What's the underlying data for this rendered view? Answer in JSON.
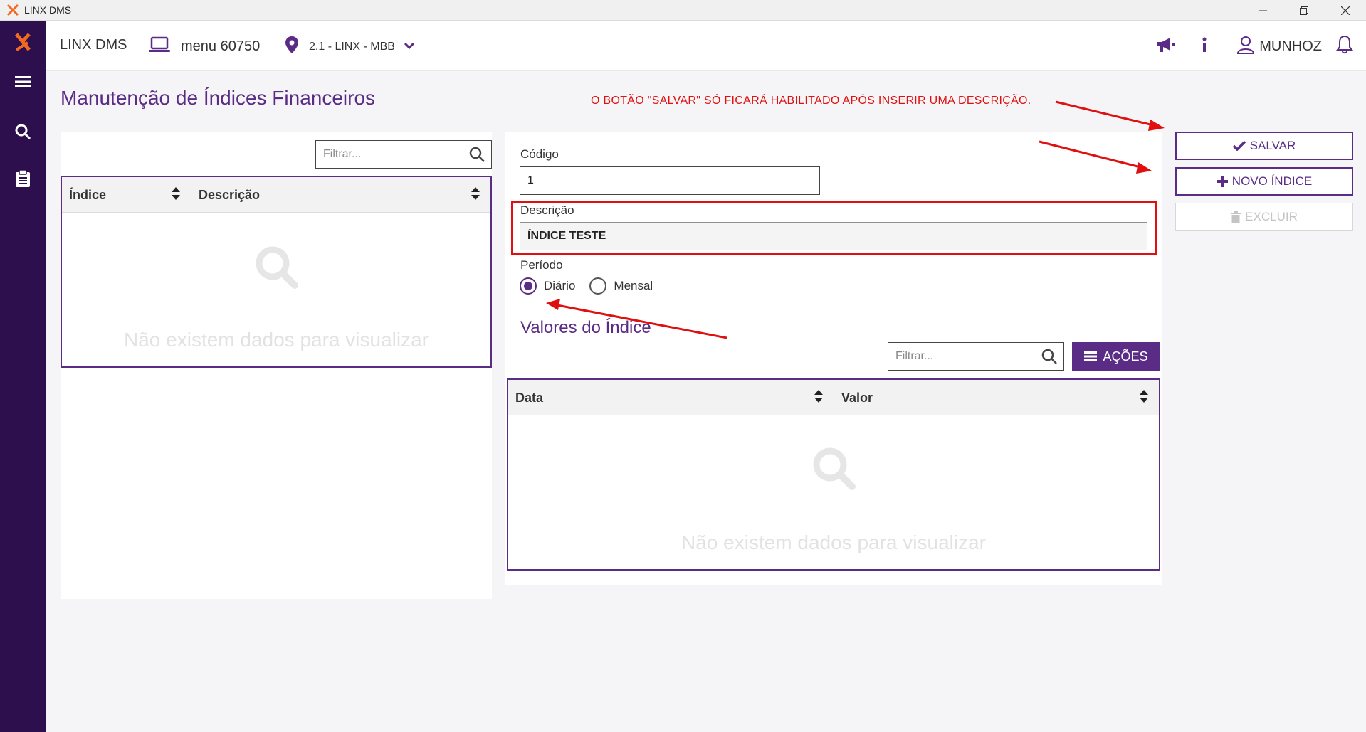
{
  "window": {
    "title": "LINX DMS"
  },
  "header": {
    "brand": "LINX DMS",
    "menu_label": "menu 60750",
    "location_label": "2.1 - LINX - MBB",
    "user_name": "MUNHOZ"
  },
  "page": {
    "title": "Manutenção de Índices Financeiros",
    "annotation": "O BOTÃO \"SALVAR\" SÓ FICARÁ HABILITADO APÓS INSERIR UMA DESCRIÇÃO."
  },
  "left_grid": {
    "filter_placeholder": "Filtrar...",
    "columns": [
      "Índice",
      "Descrição"
    ],
    "empty_text": "Não existem dados para visualizar"
  },
  "form": {
    "codigo_label": "Código",
    "codigo_value": "1",
    "descricao_label": "Descrição",
    "descricao_value": "ÍNDICE TESTE",
    "periodo_label": "Período",
    "periodo_options": [
      "Diário",
      "Mensal"
    ],
    "periodo_selected": "Diário"
  },
  "valores": {
    "title": "Valores do Índice",
    "filter_placeholder": "Filtrar...",
    "acoes_label": "AÇÕES",
    "columns": [
      "Data",
      "Valor"
    ],
    "empty_text": "Não existem dados para visualizar"
  },
  "actions": {
    "save_label": "SALVAR",
    "new_label": "NOVO ÍNDICE",
    "delete_label": "EXCLUIR"
  },
  "colors": {
    "brand_purple": "#5b2c86",
    "sidebar": "#2e0f4e",
    "annotation_red": "#e01010",
    "logo_orange": "#f26a21"
  },
  "icons": [
    "linx-logo-icon",
    "minimize-icon",
    "restore-icon",
    "close-icon",
    "menu-icon",
    "search-icon",
    "clipboard-icon",
    "laptop-icon",
    "location-pin-icon",
    "chevron-down-icon",
    "megaphone-icon",
    "info-icon",
    "user-icon",
    "bell-icon",
    "sort-icon",
    "check-icon",
    "plus-icon",
    "trash-icon",
    "list-icon"
  ]
}
